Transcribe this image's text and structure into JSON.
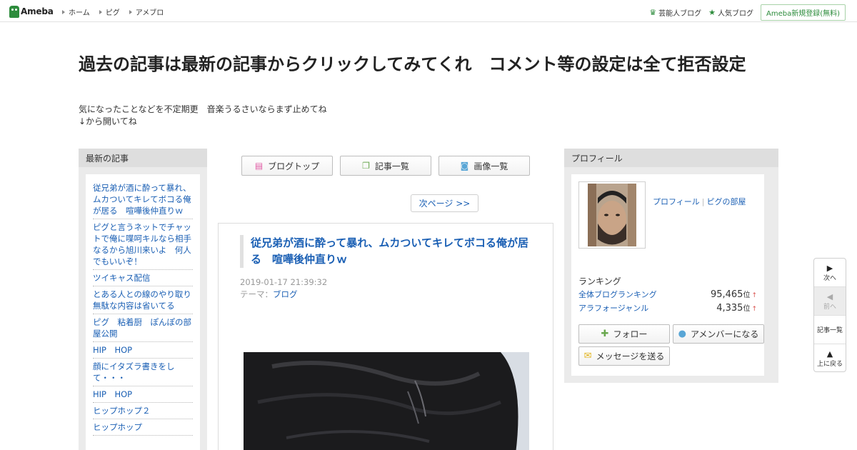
{
  "header": {
    "logo_text": "Ameba",
    "nav": [
      {
        "label": "ホーム"
      },
      {
        "label": "ピグ"
      },
      {
        "label": "アメブロ"
      }
    ],
    "right_links": [
      {
        "label": "芸能人ブログ",
        "icon": "crown-icon"
      },
      {
        "label": "人気ブログ",
        "icon": "star-icon"
      }
    ],
    "signup_label": "Ameba新規登録(無料)"
  },
  "blog": {
    "title": "過去の記事は最新の記事からクリックしてみてくれ　コメント等の設定は全て拒否設定",
    "description": "気になったことなどを不定期更　音楽うるさいならまず止めてね\n↓から開いてね"
  },
  "sidebar_left": {
    "heading": "最新の記事",
    "items": [
      {
        "label": "従兄弟が酒に酔って暴れ、ムカついてキレてボコる俺が居る　喧嘩後仲直りｗ"
      },
      {
        "label": "ピグと言うネットでチャットで俺に喋呵キルなら相手なるから旭川来いよ　何人でもいいぞ！"
      },
      {
        "label": "ツイキャス配信"
      },
      {
        "label": "とある人との線のやり取り　無駄な内容は省いてる"
      },
      {
        "label": "ピグ　粘着厨　ぽんぽの部屋公開"
      },
      {
        "label": "HIP　HOP"
      },
      {
        "label": "顔にイタズラ書きをして・・・"
      },
      {
        "label": "HIP　HOP"
      },
      {
        "label": "ヒップホップ２"
      },
      {
        "label": "ヒップホップ"
      }
    ]
  },
  "center": {
    "buttons": [
      {
        "label": "ブログトップ",
        "icon": "document-icon"
      },
      {
        "label": "記事一覧",
        "icon": "copy-icon"
      },
      {
        "label": "画像一覧",
        "icon": "camera-icon"
      }
    ],
    "next_page_label": "次ページ >>",
    "entry": {
      "title": "従兄弟が酒に酔って暴れ、ムカついてキレてボコる俺が居る　喧嘩後仲直りｗ",
      "date": "2019-01-17 21:39:32",
      "theme_prefix": "テーマ：",
      "theme": "ブログ"
    }
  },
  "profile": {
    "heading": "プロフィール",
    "link_profile": "プロフィール",
    "link_room": "ピグの部屋",
    "ranking_title": "ランキング",
    "rankings": [
      {
        "label": "全体ブログランキング",
        "value": "95,465",
        "unit": "位",
        "trend": "↑"
      },
      {
        "label": "アラフォージャンル",
        "value": "4,335",
        "unit": "位",
        "trend": "↑"
      }
    ],
    "follow_label": "フォロー",
    "member_label": "アメンバーになる",
    "message_label": "メッセージを送る"
  },
  "float_nav": {
    "next": "次へ",
    "prev": "前へ",
    "list": "記事一覧",
    "top": "上に戻る"
  },
  "colors": {
    "link": "#1a5fb4",
    "brand_green": "#2d8c3c",
    "rank_up": "#d9534f"
  }
}
